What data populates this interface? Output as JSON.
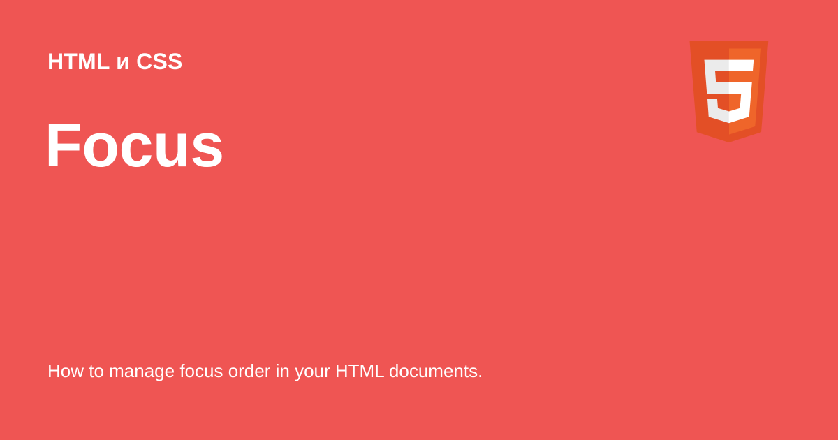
{
  "card": {
    "kicker": "HTML и CSS",
    "title": "Focus",
    "description": "How to manage focus order in your HTML documents.",
    "logo_icon": "html5-shield-icon",
    "background_color": "#ef5553",
    "logo_colors": {
      "shield_dark": "#e34f26",
      "shield_light": "#ef652a",
      "glyph_light": "#ebebeb",
      "glyph_white": "#ffffff"
    }
  }
}
